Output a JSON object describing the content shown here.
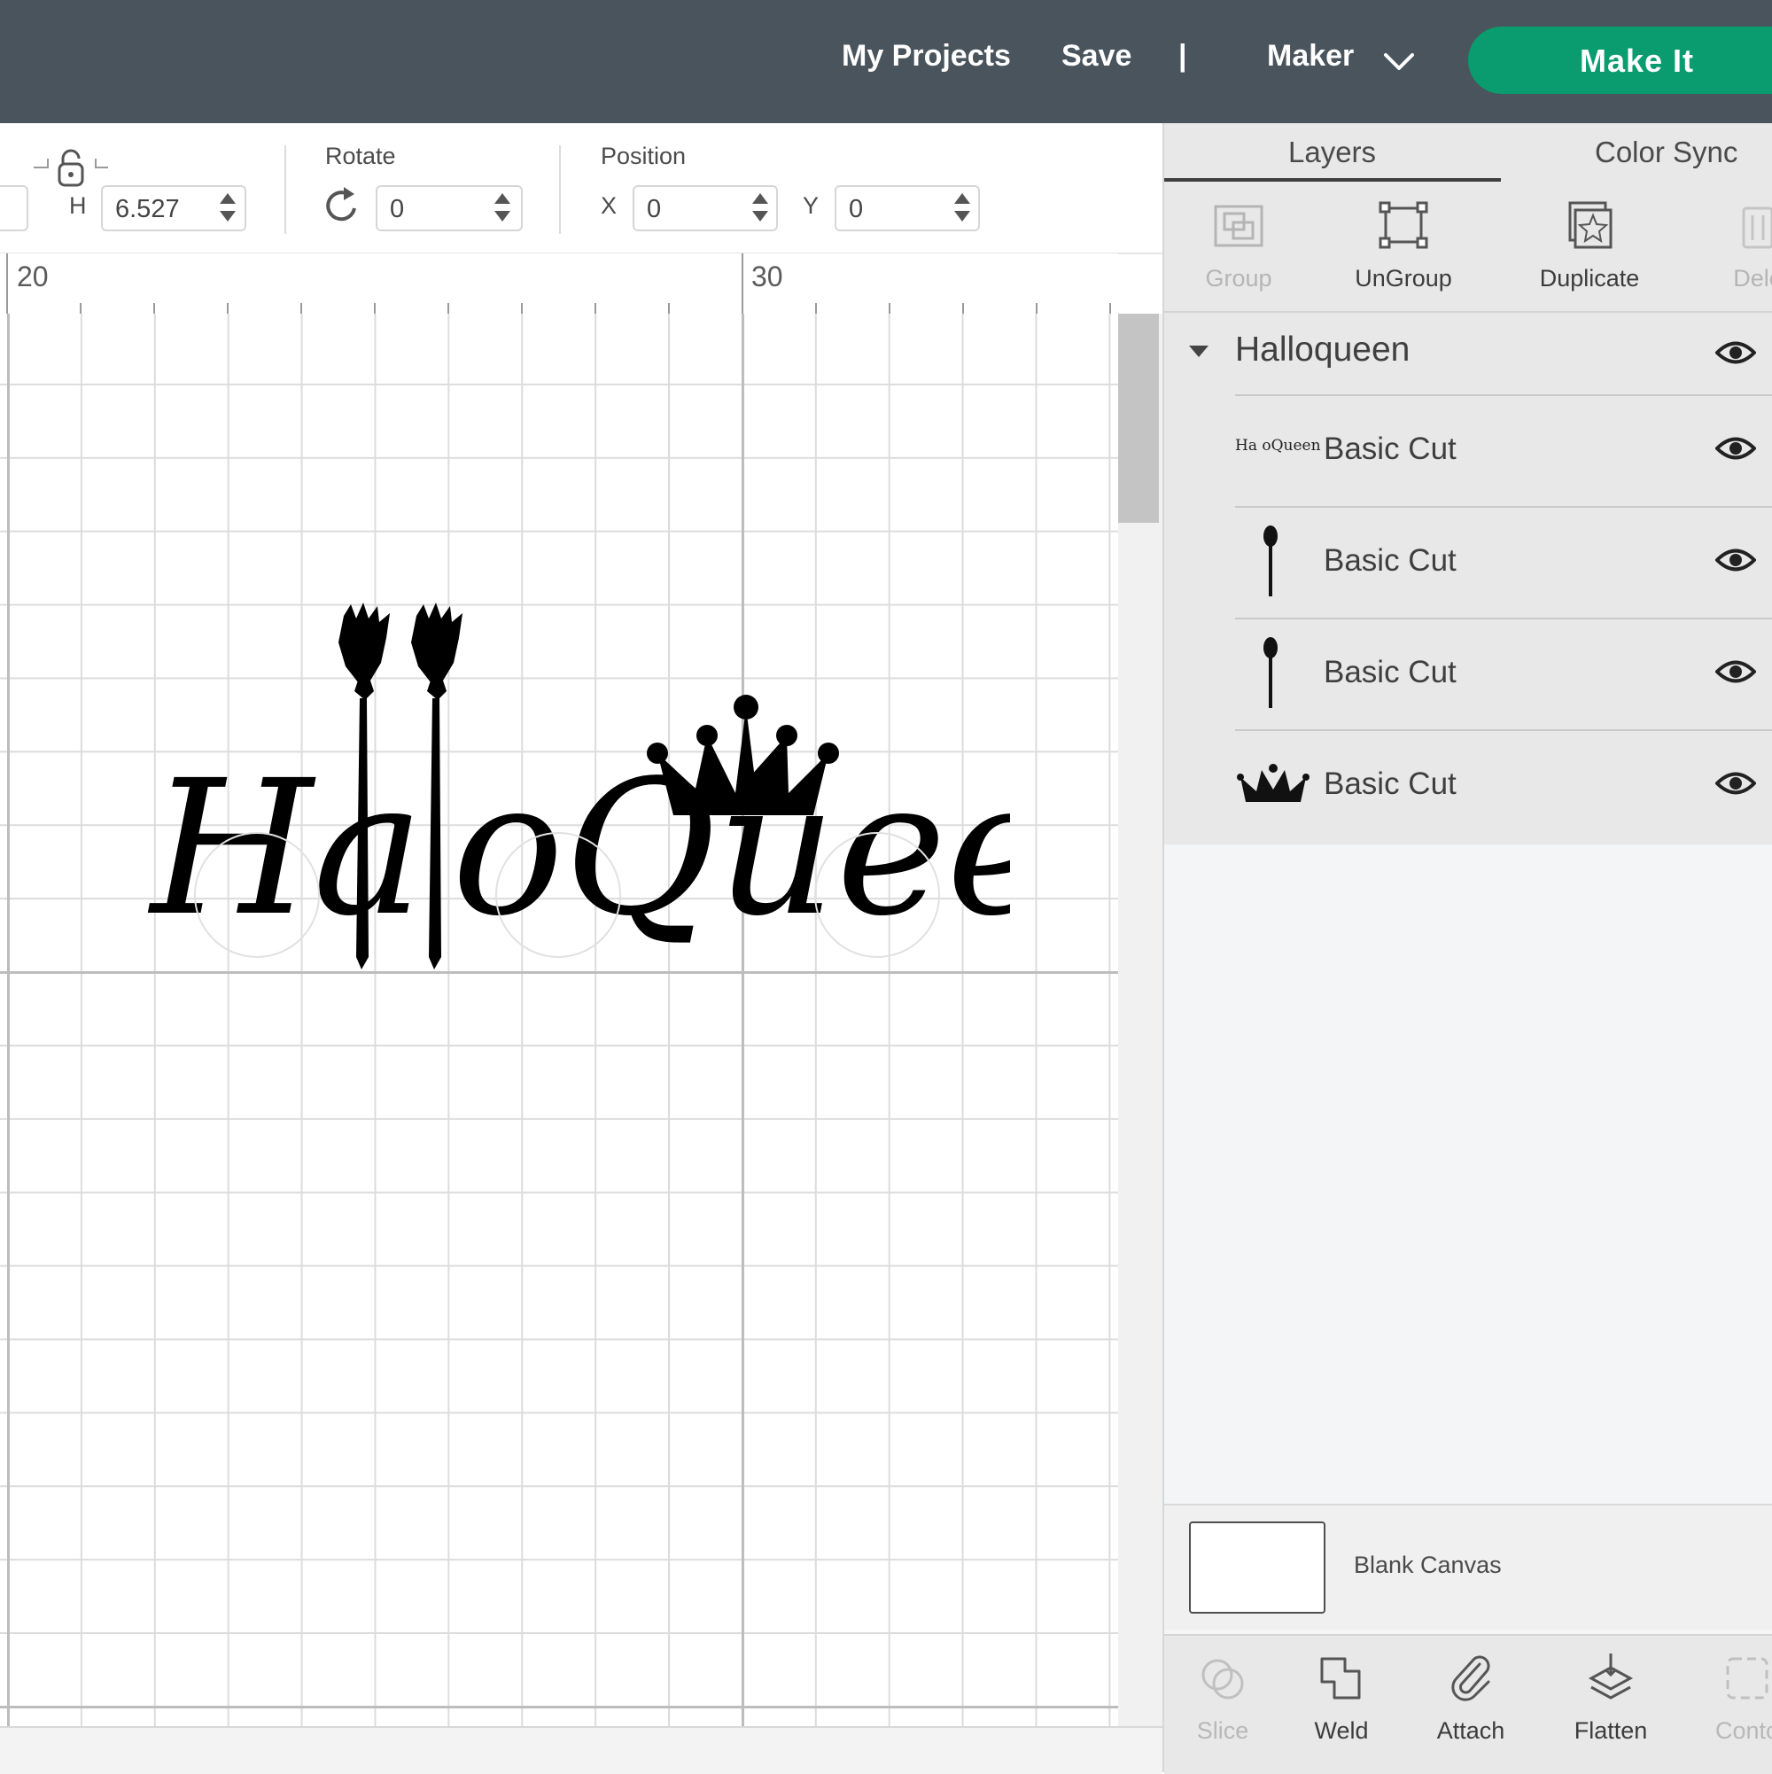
{
  "topbar": {
    "my_projects": "My Projects",
    "save": "Save",
    "separator": "|",
    "machine": "Maker",
    "make_it": "Make It",
    "accent_color": "#0a9b6e"
  },
  "toolbar": {
    "height_label": "H",
    "height_value": "6.527",
    "rotate_label": "Rotate",
    "rotate_value": "0",
    "position_label": "Position",
    "x_label": "X",
    "x_value": "0",
    "y_label": "Y",
    "y_value": "0"
  },
  "ruler": {
    "marks": [
      "20",
      "30"
    ]
  },
  "canvas": {
    "artwork_text": "HalloQueen"
  },
  "panel": {
    "tabs": [
      "Layers",
      "Color Sync"
    ],
    "actions": [
      {
        "label": "Group",
        "icon": "group-icon",
        "enabled": false
      },
      {
        "label": "UnGroup",
        "icon": "ungroup-icon",
        "enabled": true
      },
      {
        "label": "Duplicate",
        "icon": "duplicate-icon",
        "enabled": true
      },
      {
        "label": "Dele",
        "icon": "delete-icon",
        "enabled": false
      }
    ],
    "group_name": "Halloqueen",
    "layers": [
      {
        "name": "Basic Cut",
        "thumb": "Ha oQueen",
        "icon": "text-thumbnail-icon"
      },
      {
        "name": "Basic Cut",
        "icon": "broom-thumbnail-icon"
      },
      {
        "name": "Basic Cut",
        "icon": "broom-thumbnail-icon"
      },
      {
        "name": "Basic Cut",
        "icon": "crown-thumbnail-icon"
      }
    ],
    "blank_canvas": "Blank Canvas",
    "bottom_actions": [
      {
        "label": "Slice",
        "icon": "slice-icon",
        "enabled": false
      },
      {
        "label": "Weld",
        "icon": "weld-icon",
        "enabled": true
      },
      {
        "label": "Attach",
        "icon": "attach-icon",
        "enabled": true
      },
      {
        "label": "Flatten",
        "icon": "flatten-icon",
        "enabled": true
      },
      {
        "label": "Conto",
        "icon": "contour-icon",
        "enabled": false
      }
    ]
  }
}
